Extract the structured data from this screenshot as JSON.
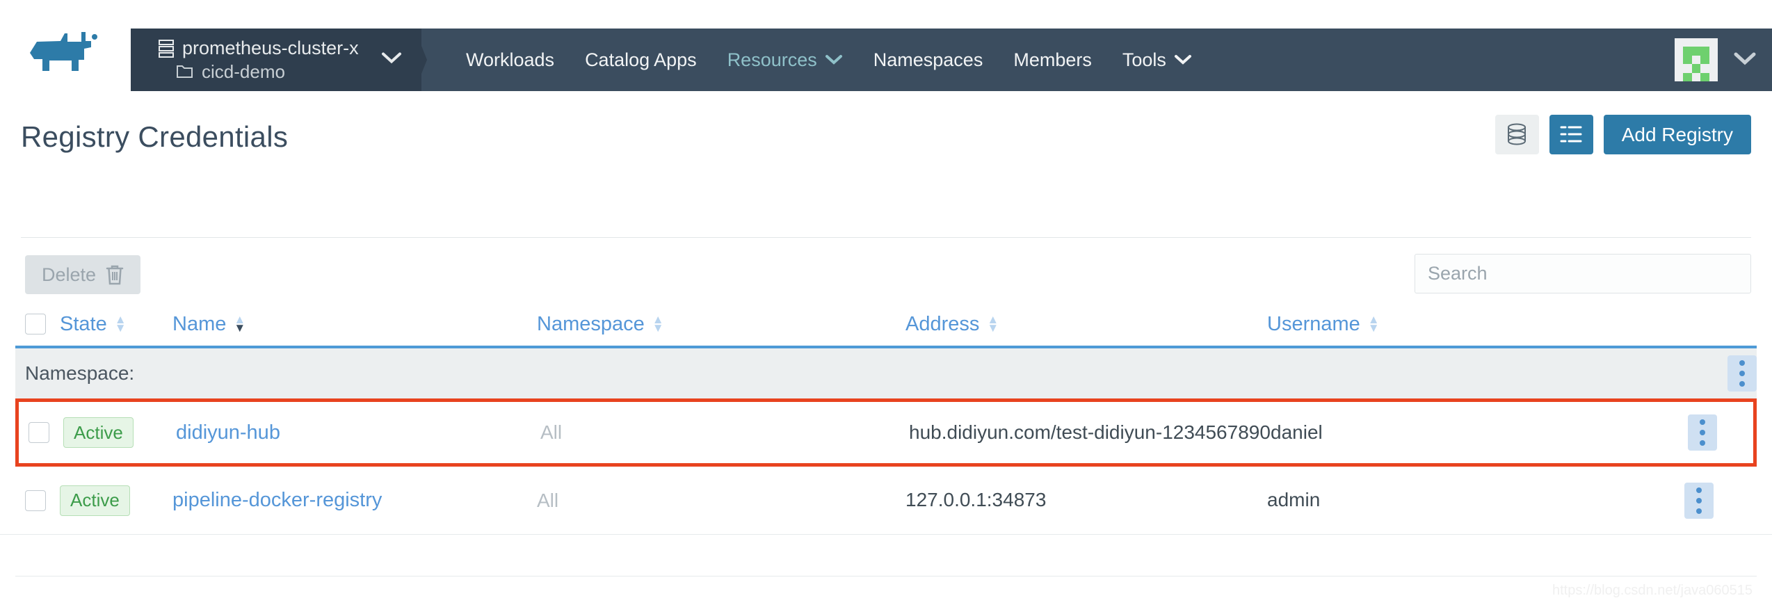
{
  "nav": {
    "cluster": {
      "name": "prometheus-cluster-x",
      "project": "cicd-demo",
      "cluster_icon": "server-stack-icon",
      "project_icon": "folder-icon",
      "caret_icon": "chevron-down-icon"
    },
    "links": [
      {
        "label": "Workloads",
        "active": false,
        "caret": false
      },
      {
        "label": "Catalog Apps",
        "active": false,
        "caret": false
      },
      {
        "label": "Resources",
        "active": true,
        "caret": true
      },
      {
        "label": "Namespaces",
        "active": false,
        "caret": false
      },
      {
        "label": "Members",
        "active": false,
        "caret": false
      },
      {
        "label": "Tools",
        "active": false,
        "caret": true
      }
    ],
    "user": {
      "avatar_icon": "user-identicon-avatar",
      "caret_icon": "chevron-down-icon"
    },
    "logo_icon": "rancher-cow-logo",
    "accent_dark": "#3b4d5f",
    "accent_chip": "#2f3e4e"
  },
  "header": {
    "title": "Registry Credentials",
    "view_toggle": [
      {
        "icon": "database-stack-icon",
        "selected": false
      },
      {
        "icon": "list-view-icon",
        "selected": true
      }
    ],
    "add_button": "Add Registry",
    "primary_color": "#2d7ba8"
  },
  "toolbar": {
    "delete_label": "Delete",
    "delete_icon": "trash-icon",
    "delete_disabled": true,
    "search_placeholder": "Search",
    "search_value": ""
  },
  "table": {
    "columns": [
      {
        "label": "State",
        "sortable": true,
        "sorted": "none"
      },
      {
        "label": "Name",
        "sortable": true,
        "sorted": "desc"
      },
      {
        "label": "Namespace",
        "sortable": true,
        "sorted": "none"
      },
      {
        "label": "Address",
        "sortable": true,
        "sorted": "none"
      },
      {
        "label": "Username",
        "sortable": true,
        "sorted": "none"
      }
    ],
    "group_row": {
      "label": "Namespace:",
      "menu_icon": "kebab-menu-icon"
    },
    "rows": [
      {
        "state": "Active",
        "name": "didiyun-hub",
        "namespace": "All",
        "address": "hub.didiyun.com/test-didiyun-1234567890",
        "username": "daniel",
        "highlighted": true,
        "menu_icon": "kebab-menu-icon"
      },
      {
        "state": "Active",
        "name": "pipeline-docker-registry",
        "namespace": "All",
        "address": "127.0.0.1:34873",
        "username": "admin",
        "highlighted": false,
        "menu_icon": "kebab-menu-icon"
      }
    ],
    "highlight_color": "#e8431f",
    "link_color": "#5596d8",
    "badge_color": "#3c9c4a"
  },
  "watermark": "https://blog.csdn.net/java060515"
}
